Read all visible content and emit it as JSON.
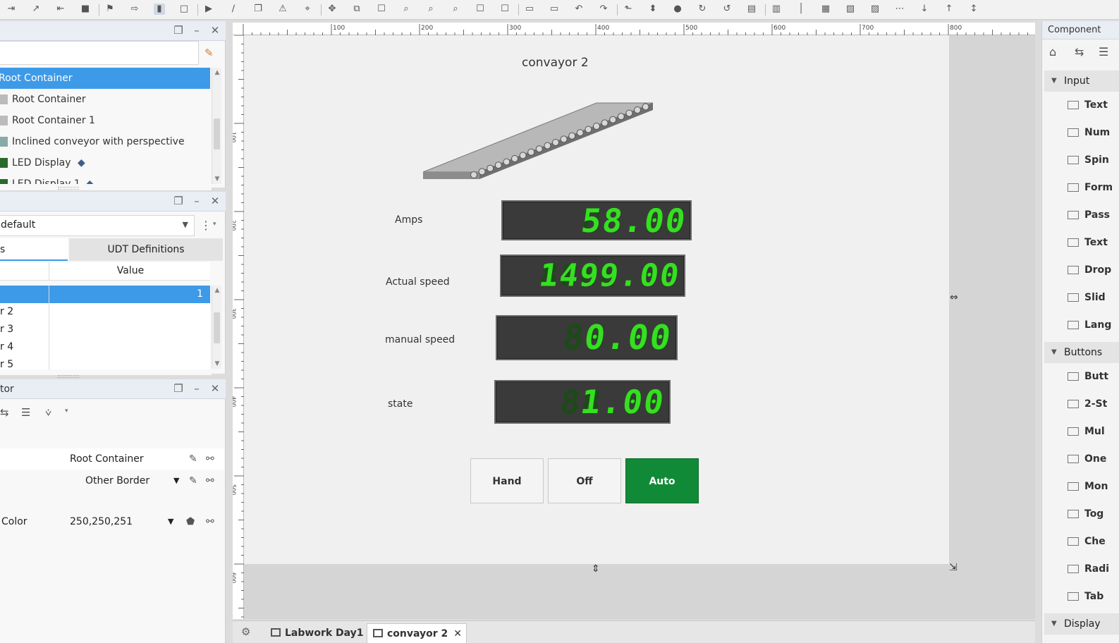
{
  "project_browser": {
    "tree": [
      {
        "label": "Root Container",
        "selected": true
      },
      {
        "label": "Root Container",
        "selected": false
      },
      {
        "label": "Root Container 1",
        "selected": false
      },
      {
        "label": "Inclined conveyor with perspective",
        "selected": false
      },
      {
        "label": "LED Display",
        "selected": false
      },
      {
        "label": "LED Display 1",
        "selected": false
      }
    ]
  },
  "tag_browser": {
    "provider": "default",
    "tabs": [
      "s",
      "UDT Definitions"
    ],
    "columns": [
      "",
      "Value"
    ],
    "rows": [
      {
        "name": "",
        "value": "1"
      },
      {
        "name": "r 2",
        "value": ""
      },
      {
        "name": "r 3",
        "value": ""
      },
      {
        "name": "r 4",
        "value": ""
      },
      {
        "name": "r 5",
        "value": ""
      }
    ]
  },
  "property_editor": {
    "title": "tor",
    "rows": [
      {
        "label": "",
        "value": "Root Container"
      },
      {
        "label": "",
        "value": "Other Border"
      },
      {
        "label": "Color",
        "value": "250,250,251"
      }
    ]
  },
  "ruler": {
    "top_ticks": [
      "100",
      "200",
      "300",
      "400",
      "500",
      "600",
      "700",
      "800"
    ],
    "left_ticks": [
      "100",
      "200",
      "300",
      "400",
      "500",
      "600"
    ]
  },
  "window": {
    "title": "convayor 2",
    "labels": {
      "amps": "Amps",
      "actual_speed": "Actual speed",
      "manual_speed": "manual speed",
      "state": "state"
    },
    "displays": {
      "amps": {
        "value": "58.00",
        "ghost": "88.88"
      },
      "actual_speed": {
        "value": "1499.00",
        "ghost": "8888.88"
      },
      "manual_speed": {
        "value": "0.00",
        "ghost": "88.88"
      },
      "state": {
        "value": "1.00",
        "ghost": "88.88"
      }
    },
    "buttons": {
      "hand": "Hand",
      "off": "Off",
      "auto": "Auto"
    },
    "colors": {
      "led_on": "#34e01f",
      "auto_button": "#118a37",
      "selection": "#3d9ae8"
    }
  },
  "doc_tabs": [
    "Labwork Day1",
    "convayor 2"
  ],
  "palette": {
    "title": "Component",
    "groups": [
      {
        "label": "Input",
        "items": [
          "Text",
          "Num",
          "Spin",
          "Form",
          "Pass",
          "Text",
          "Drop",
          "Slid",
          "Lang"
        ]
      },
      {
        "label": "Buttons",
        "items": [
          "Butt",
          "2-St",
          "Mul",
          "One",
          "Mon",
          "Tog",
          "Che",
          "Radi",
          "Tab"
        ]
      },
      {
        "label": "Display",
        "items": []
      }
    ]
  }
}
